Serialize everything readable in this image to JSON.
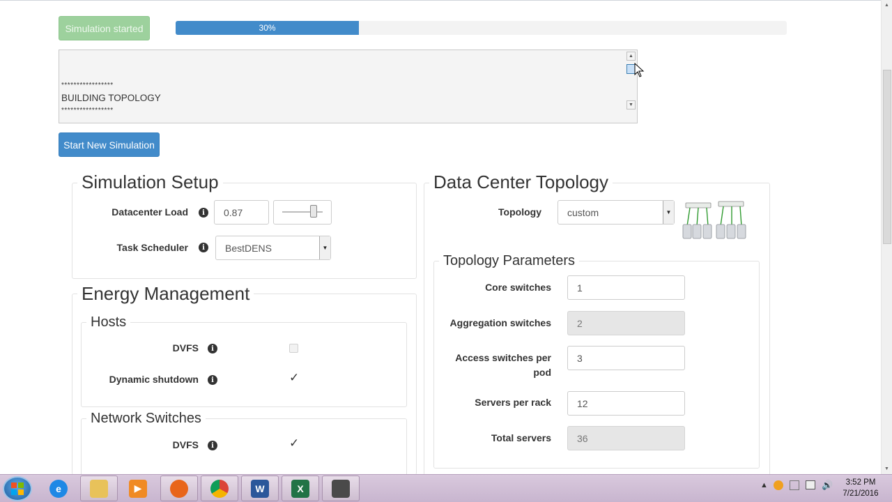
{
  "status": {
    "started_label": "Simulation started",
    "progress_label": "30%",
    "progress_value": 0.3
  },
  "log": {
    "stars_top": "*****************",
    "line": "BUILDING TOPOLOGY",
    "stars_bottom": "*****************"
  },
  "actions": {
    "new_simulation_label": "Start New Simulation"
  },
  "simulation_setup": {
    "title": "Simulation Setup",
    "datacenter_load_label": "Datacenter Load",
    "datacenter_load_value": "0.87",
    "task_scheduler_label": "Task Scheduler",
    "task_scheduler_value": "BestDENS"
  },
  "energy_management": {
    "title": "Energy Management",
    "hosts": {
      "title": "Hosts",
      "dvfs_label": "DVFS",
      "dvfs_checked": false,
      "dynamic_shutdown_label": "Dynamic shutdown",
      "dynamic_shutdown_checked": true
    },
    "network_switches": {
      "title": "Network Switches",
      "dvfs_label": "DVFS",
      "dvfs_checked": true
    },
    "check_glyph": "✓"
  },
  "topology": {
    "title": "Data Center Topology",
    "topology_label": "Topology",
    "topology_value": "custom",
    "parameters": {
      "title": "Topology Parameters",
      "core_switches_label": "Core switches",
      "core_switches_value": "1",
      "aggregation_switches_label": "Aggregation switches",
      "aggregation_switches_value": "2",
      "access_switches_label_1": "Access switches per",
      "access_switches_label_2": "pod",
      "access_switches_value": "3",
      "servers_per_rack_label": "Servers per rack",
      "servers_per_rack_value": "12",
      "total_servers_label": "Total servers",
      "total_servers_value": "36"
    }
  },
  "taskbar": {
    "apps": [
      "internet-explorer",
      "file-explorer",
      "media-player",
      "firefox",
      "chrome",
      "word",
      "excel",
      "app"
    ],
    "clock_time": "3:52 PM",
    "clock_date": "7/21/2016"
  },
  "colors": {
    "primary": "#428bca",
    "success": "#9dd19d"
  }
}
